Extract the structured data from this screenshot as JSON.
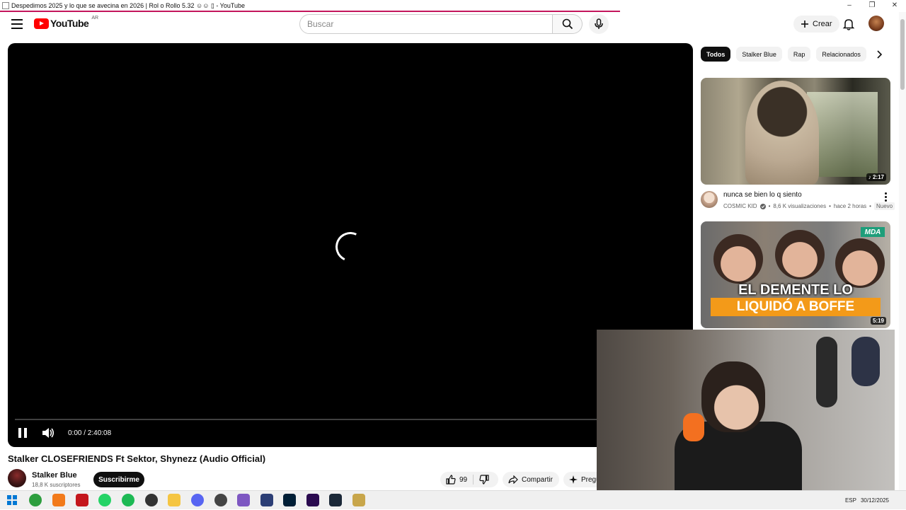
{
  "window": {
    "title": "Despedimos 2025 y lo que se avecina en 2026 | Rol o Rollo 5.32 ☺☺ ▯ - YouTube",
    "controls": [
      "–",
      "❐",
      "✕"
    ]
  },
  "header": {
    "logo_text": "YouTube",
    "country_code": "AR",
    "search_placeholder": "Buscar",
    "create_label": "Crear"
  },
  "player": {
    "timecode": "0:00 / 2:40:08",
    "state": "loading"
  },
  "video": {
    "title": "Stalker CLOSEFRIENDS Ft Sektor, Shynezz (Audio Official)",
    "channel_name": "Stalker Blue",
    "subscribers": "18,8 K suscriptores",
    "subscribe_label": "Suscribirme",
    "like_count": "99",
    "share_label": "Compartir",
    "ask_label": "Pregu"
  },
  "chips": [
    "Todos",
    "Stalker Blue",
    "Rap",
    "Relacionados"
  ],
  "recommendations": [
    {
      "title": "nunca se bien lo q siento",
      "channel": "COSMIC KID",
      "views": "8,6 K visualizaciones",
      "age": "hace 2 horas",
      "badge": "Nuevo",
      "duration": "2:17"
    },
    {
      "thumb_header": "MDA",
      "thumb_line1": "EL DEMENTE LO",
      "thumb_line2": "LIQUIDÓ A BOFFE",
      "duration": "5:19"
    }
  ],
  "taskbar": {
    "tray_lang": "ESP",
    "time": "30/12/2025"
  },
  "colors": {
    "yt_red": "#ff0000",
    "loading_bar": "#c3165c",
    "chip_active": "#0f0f0f",
    "orange_caption": "#f39a19"
  }
}
